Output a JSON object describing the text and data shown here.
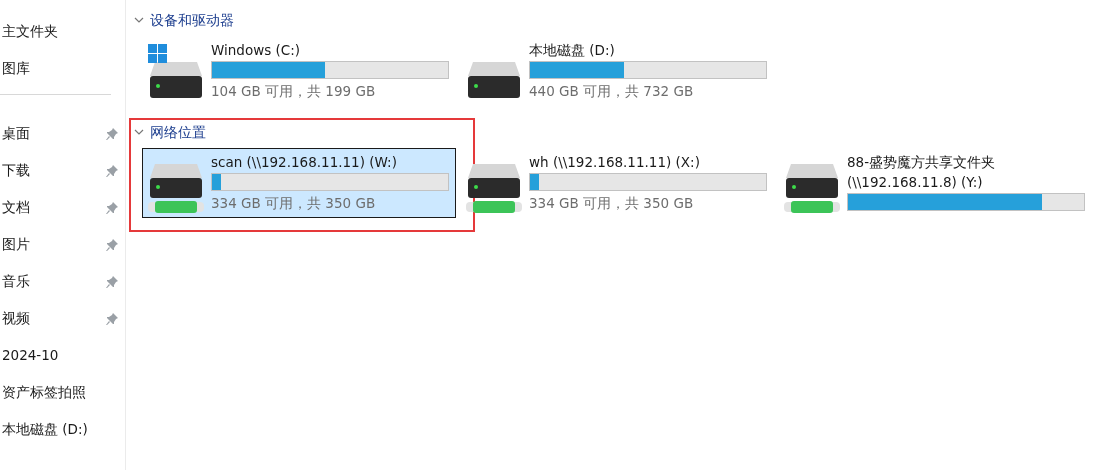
{
  "sidebar": {
    "items": [
      {
        "label": "主文件夹",
        "pinned": false
      },
      {
        "label": "图库",
        "pinned": false
      },
      {
        "kind": "divider"
      },
      {
        "label": "桌面",
        "pinned": true
      },
      {
        "label": "下载",
        "pinned": true
      },
      {
        "label": "文档",
        "pinned": true
      },
      {
        "label": "图片",
        "pinned": true
      },
      {
        "label": "音乐",
        "pinned": true
      },
      {
        "label": "视频",
        "pinned": true
      },
      {
        "label": "2024-10",
        "pinned": false
      },
      {
        "label": "资产标签拍照",
        "pinned": false
      },
      {
        "label": "本地磁盘 (D:)",
        "pinned": false
      }
    ]
  },
  "sections": [
    {
      "title": "设备和驱动器",
      "expanded": true,
      "outlined": false,
      "drives": [
        {
          "kind": "system",
          "name": "Windows (C:)",
          "level": 0.48,
          "space": "104 GB 可用，共 199 GB",
          "selected": false
        },
        {
          "kind": "local",
          "name": "本地磁盘 (D:)",
          "level": 0.4,
          "space": "440 GB 可用，共 732 GB",
          "selected": false
        }
      ]
    },
    {
      "title": "网络位置",
      "expanded": true,
      "outlined": true,
      "drives": [
        {
          "kind": "network",
          "name": "scan (\\\\192.168.11.11) (W:)",
          "level": 0.04,
          "space": "334 GB 可用，共 350 GB",
          "selected": true
        },
        {
          "kind": "network",
          "name": "wh (\\\\192.168.11.11) (X:)",
          "level": 0.04,
          "space": "334 GB 可用，共 350 GB",
          "selected": false
        },
        {
          "kind": "network",
          "name": "88-盛势魔方共享文件夹 (\\\\192.168.11.8) (Y:)",
          "level": 0.82,
          "selected": false
        }
      ]
    }
  ]
}
